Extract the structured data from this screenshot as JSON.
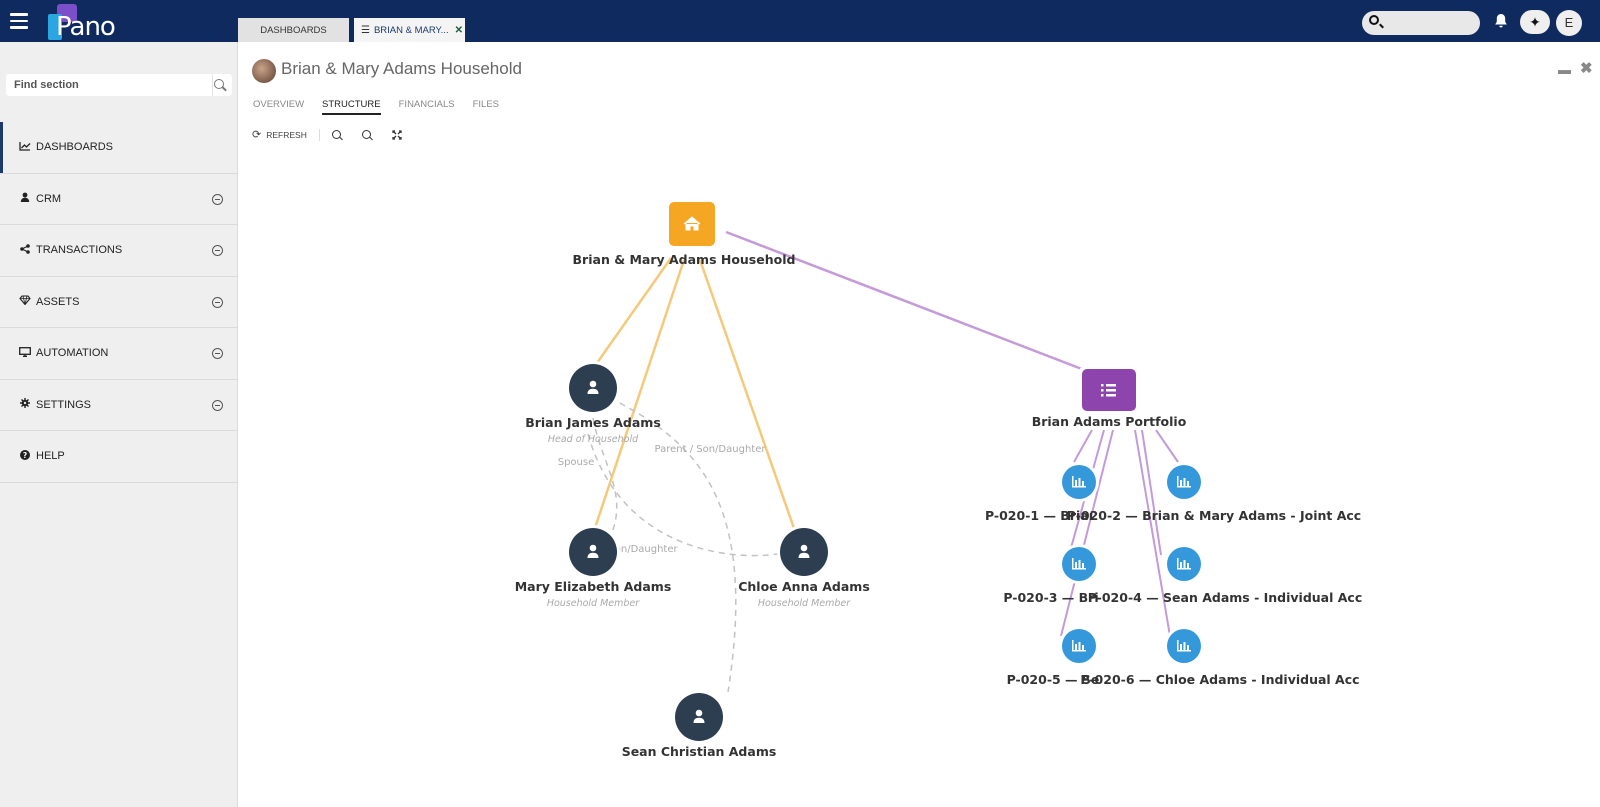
{
  "topbar": {
    "logo_text": "Pano",
    "tabs": [
      {
        "label": "DASHBOARDS"
      },
      {
        "label": "BRIAN & MARY..."
      }
    ],
    "user_initial": "E",
    "colors": {
      "bar": "#0f2a5e",
      "logo_purple": "#7b4fc9",
      "logo_blue": "#2aa6e0"
    }
  },
  "sidebar": {
    "search_placeholder": "Find section",
    "items": [
      {
        "label": "DASHBOARDS",
        "icon": "chart-line-icon",
        "expandable": false
      },
      {
        "label": "CRM",
        "icon": "user-icon",
        "expandable": true
      },
      {
        "label": "TRANSACTIONS",
        "icon": "share-icon",
        "expandable": true
      },
      {
        "label": "ASSETS",
        "icon": "diamond-icon",
        "expandable": true
      },
      {
        "label": "AUTOMATION",
        "icon": "desktop-icon",
        "expandable": true
      },
      {
        "label": "SETTINGS",
        "icon": "gear-icon",
        "expandable": true
      },
      {
        "label": "HELP",
        "icon": "question-icon",
        "expandable": false
      }
    ]
  },
  "main": {
    "title": "Brian & Mary Adams Household",
    "tabs": [
      "OVERVIEW",
      "STRUCTURE",
      "FINANCIALS",
      "FILES"
    ],
    "active_tab": "STRUCTURE",
    "toolbar": {
      "refresh_label": "REFRESH"
    }
  },
  "graph": {
    "colors": {
      "household": "#f5a623",
      "portfolio": "#8e44ad",
      "person": "#2c3e50",
      "account": "#3498db",
      "household_edge": "#f5c97a",
      "portfolio_edge": "#c49ad8",
      "relation_edge": "#bbbbbb"
    },
    "household": {
      "label": "Brian & Mary Adams Household",
      "icon": "home-icon"
    },
    "portfolio": {
      "label": "Brian Adams Portfolio",
      "icon": "list-icon"
    },
    "people": [
      {
        "name": "Brian James Adams",
        "role": "Head of Household"
      },
      {
        "name": "Mary Elizabeth Adams",
        "role": "Household Member"
      },
      {
        "name": "Chloe Anna Adams",
        "role": "Household Member"
      },
      {
        "name": "Sean Christian Adams",
        "role": ""
      }
    ],
    "relation_labels": [
      "Spouse",
      "Parent / Son/Daughter",
      "Son/Daughter"
    ],
    "accounts_row1": {
      "left": "P-020-1 — Briaı",
      "right": "P-020-2 — Brian & Mary Adams - Joint Acc"
    },
    "accounts_row2": {
      "left": "P-020-3 — Bri",
      "right": "P-020-4 — Sean Adams - Individual Acc"
    },
    "accounts_row3": {
      "left": "P-020-5 — Se",
      "right": "P-020-6 — Chloe Adams - Individual Acc"
    }
  }
}
